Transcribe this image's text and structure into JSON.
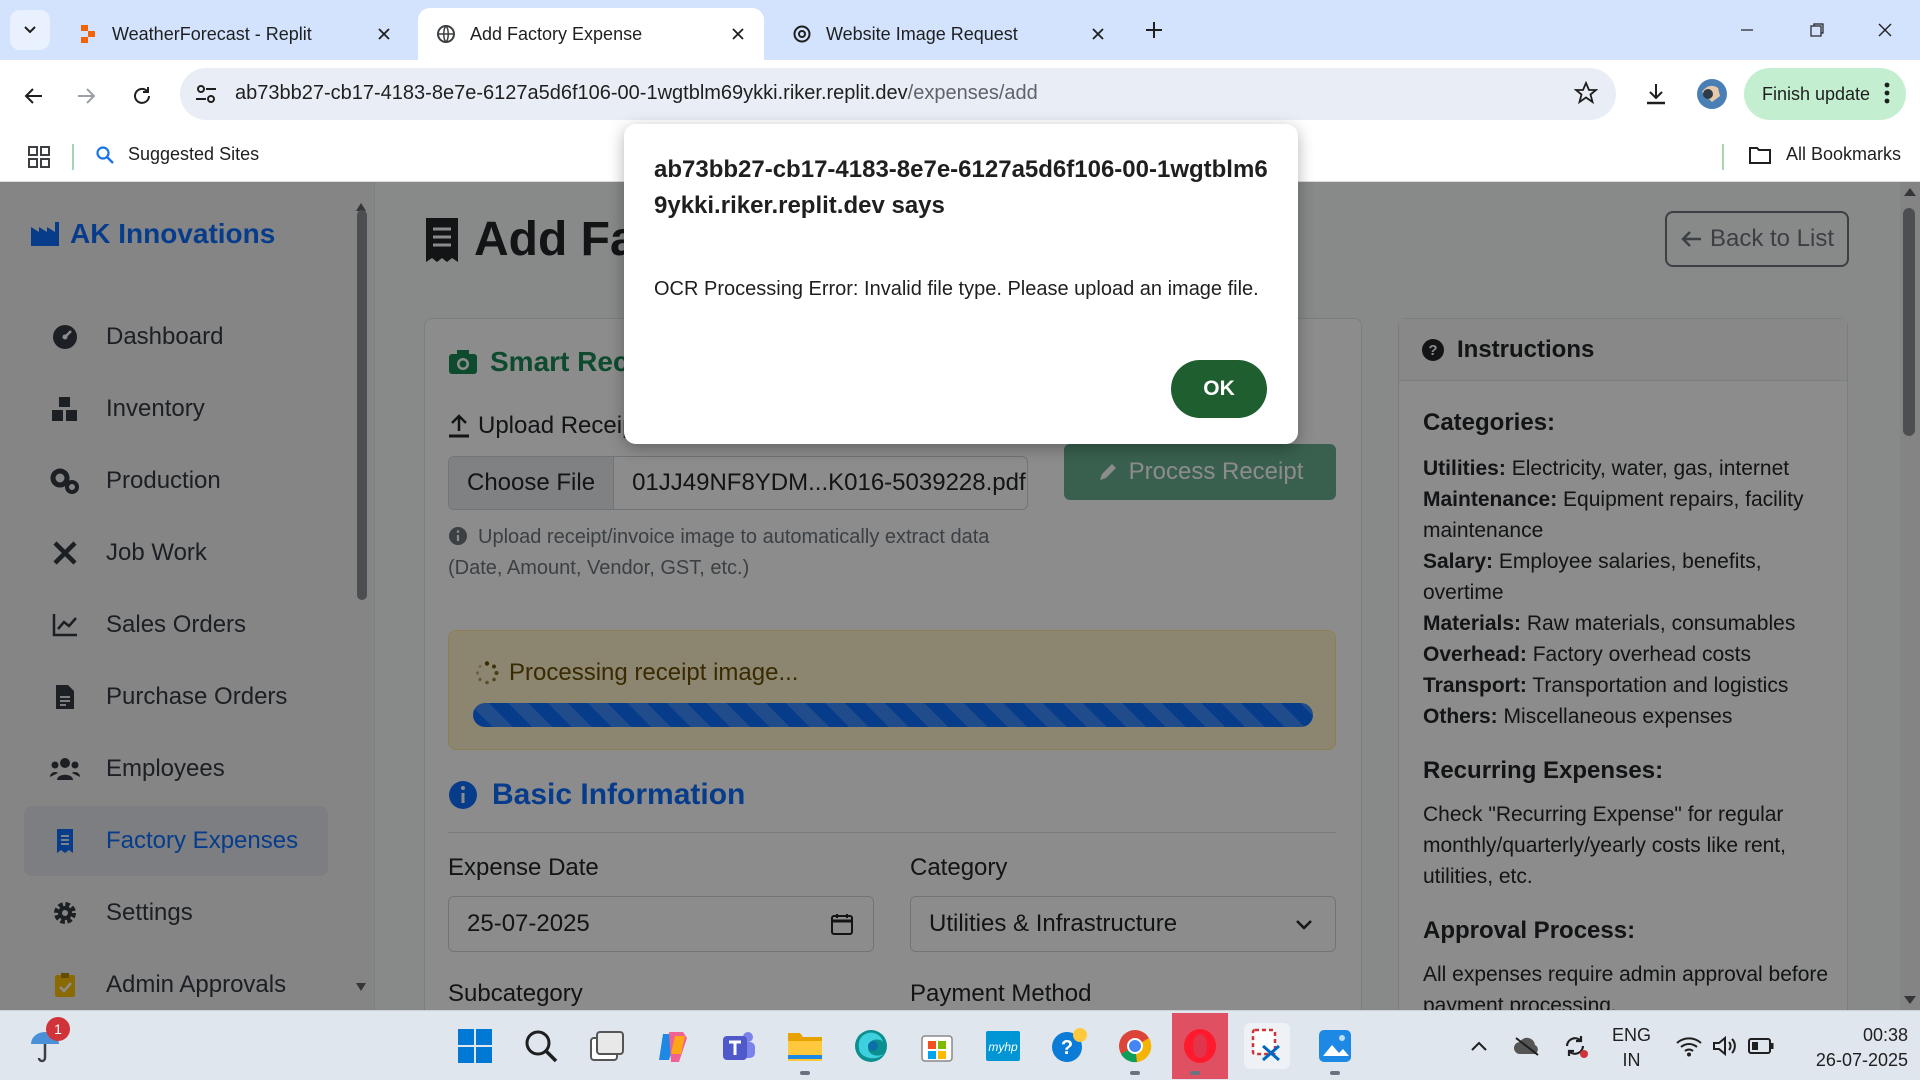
{
  "browser": {
    "tabs": [
      {
        "title": "WeatherForecast - Replit",
        "active": false
      },
      {
        "title": "Add Factory Expense",
        "active": true
      },
      {
        "title": "Website Image Request",
        "active": false
      }
    ],
    "url_host": "ab73bb27-cb17-4183-8e7e-6127a5d6f106-00-1wgtblm69ykki.riker.replit.dev",
    "url_path": "/expenses/add",
    "finish_update_label": "Finish update",
    "bookmarks": {
      "suggested": "Suggested Sites",
      "all": "All Bookmarks"
    }
  },
  "sidebar": {
    "brand": "AK Innovations",
    "items": [
      {
        "label": "Dashboard",
        "icon": "gauge-icon"
      },
      {
        "label": "Inventory",
        "icon": "boxes-icon"
      },
      {
        "label": "Production",
        "icon": "cogs-icon"
      },
      {
        "label": "Job Work",
        "icon": "tools-icon"
      },
      {
        "label": "Sales Orders",
        "icon": "chart-line-icon"
      },
      {
        "label": "Purchase Orders",
        "icon": "file-invoice-icon"
      },
      {
        "label": "Employees",
        "icon": "users-icon"
      },
      {
        "label": "Factory Expenses",
        "icon": "receipt-icon",
        "active": true
      },
      {
        "label": "Settings",
        "icon": "gear-icon"
      },
      {
        "label": "Admin Approvals",
        "icon": "clipboard-check-icon"
      }
    ]
  },
  "main": {
    "title": "Add Factory Expense",
    "back_label": "Back to List",
    "smart_receipt": {
      "heading": "Smart Receipt Scanner",
      "upload_label": "Upload Receipt",
      "choose_file_label": "Choose File",
      "file_name": "01JJ49NF8YDM...K016-5039228.pdf",
      "process_button": "Process Receipt",
      "help_text": "Upload receipt/invoice image to automatically extract data (Date, Amount, Vendor, GST, etc.)",
      "processing_text": "Processing receipt image...",
      "progress": 1.0
    },
    "basic_info": {
      "heading": "Basic Information",
      "expense_date_label": "Expense Date",
      "expense_date_value": "25-07-2025",
      "category_label": "Category",
      "category_value": "Utilities & Infrastructure",
      "subcategory_label": "Subcategory",
      "payment_method_label": "Payment Method"
    },
    "instructions": {
      "heading": "Instructions",
      "categories_heading": "Categories:",
      "categories": [
        {
          "name": "Utilities:",
          "desc": "Electricity, water, gas, internet"
        },
        {
          "name": "Maintenance:",
          "desc": "Equipment repairs, facility maintenance"
        },
        {
          "name": "Salary:",
          "desc": "Employee salaries, benefits, overtime"
        },
        {
          "name": "Materials:",
          "desc": "Raw materials, consumables"
        },
        {
          "name": "Overhead:",
          "desc": "Factory overhead costs"
        },
        {
          "name": "Transport:",
          "desc": "Transportation and logistics"
        },
        {
          "name": "Others:",
          "desc": "Miscellaneous expenses"
        }
      ],
      "recurring_heading": "Recurring Expenses:",
      "recurring_text": "Check \"Recurring Expense\" for regular monthly/quarterly/yearly costs like rent, utilities, etc.",
      "approval_heading": "Approval Process:",
      "approval_text": "All expenses require admin approval before payment processing."
    }
  },
  "dialog": {
    "title": "ab73bb27-cb17-4183-8e7e-6127a5d6f106-00-1wgtblm69ykki.riker.replit.dev says",
    "message": "OCR Processing Error: Invalid file type. Please upload an image file.",
    "ok_label": "OK"
  },
  "taskbar": {
    "notification_count": "1",
    "language": "ENG",
    "region": "IN",
    "time": "00:38",
    "date": "26-07-2025"
  },
  "colors": {
    "primary": "#0d6efd",
    "success": "#198754",
    "dialog_ok": "#1e5e2f",
    "warning_bg": "#fff3cd"
  }
}
